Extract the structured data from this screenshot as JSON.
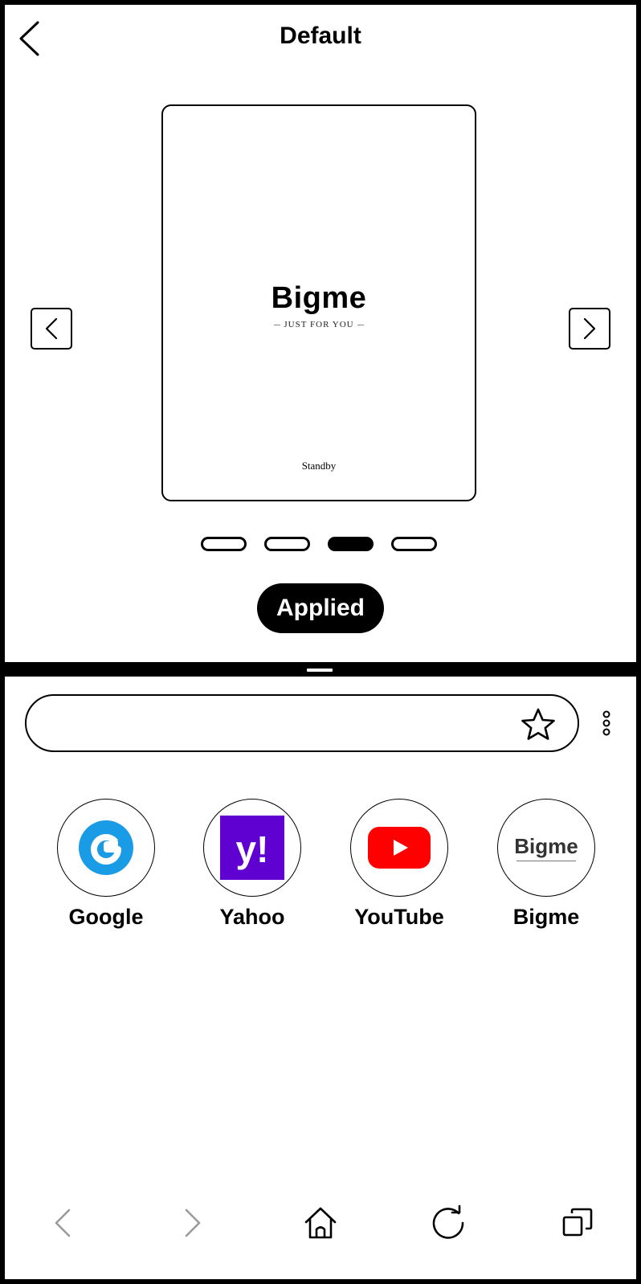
{
  "header": {
    "title": "Default"
  },
  "preview": {
    "logo_text": "Bigme",
    "tagline": "JUST FOR YOU",
    "status": "Standby"
  },
  "carousel": {
    "count": 4,
    "active_index": 2
  },
  "apply_button": {
    "label": "Applied"
  },
  "browser": {
    "search": {
      "placeholder": "",
      "value": ""
    },
    "shortcuts": [
      {
        "label": "Google",
        "icon": "google-icon",
        "color": "#1a9be6"
      },
      {
        "label": "Yahoo",
        "icon": "yahoo-icon",
        "color": "#5f01d1"
      },
      {
        "label": "YouTube",
        "icon": "youtube-icon",
        "color": "#ff0000"
      },
      {
        "label": "Bigme",
        "icon": "bigme-logo-icon",
        "color": "#333333",
        "logo_text": "Bigme"
      }
    ]
  },
  "colors": {
    "ink": "#000000",
    "paper": "#ffffff",
    "nav_disabled": "#999999"
  }
}
